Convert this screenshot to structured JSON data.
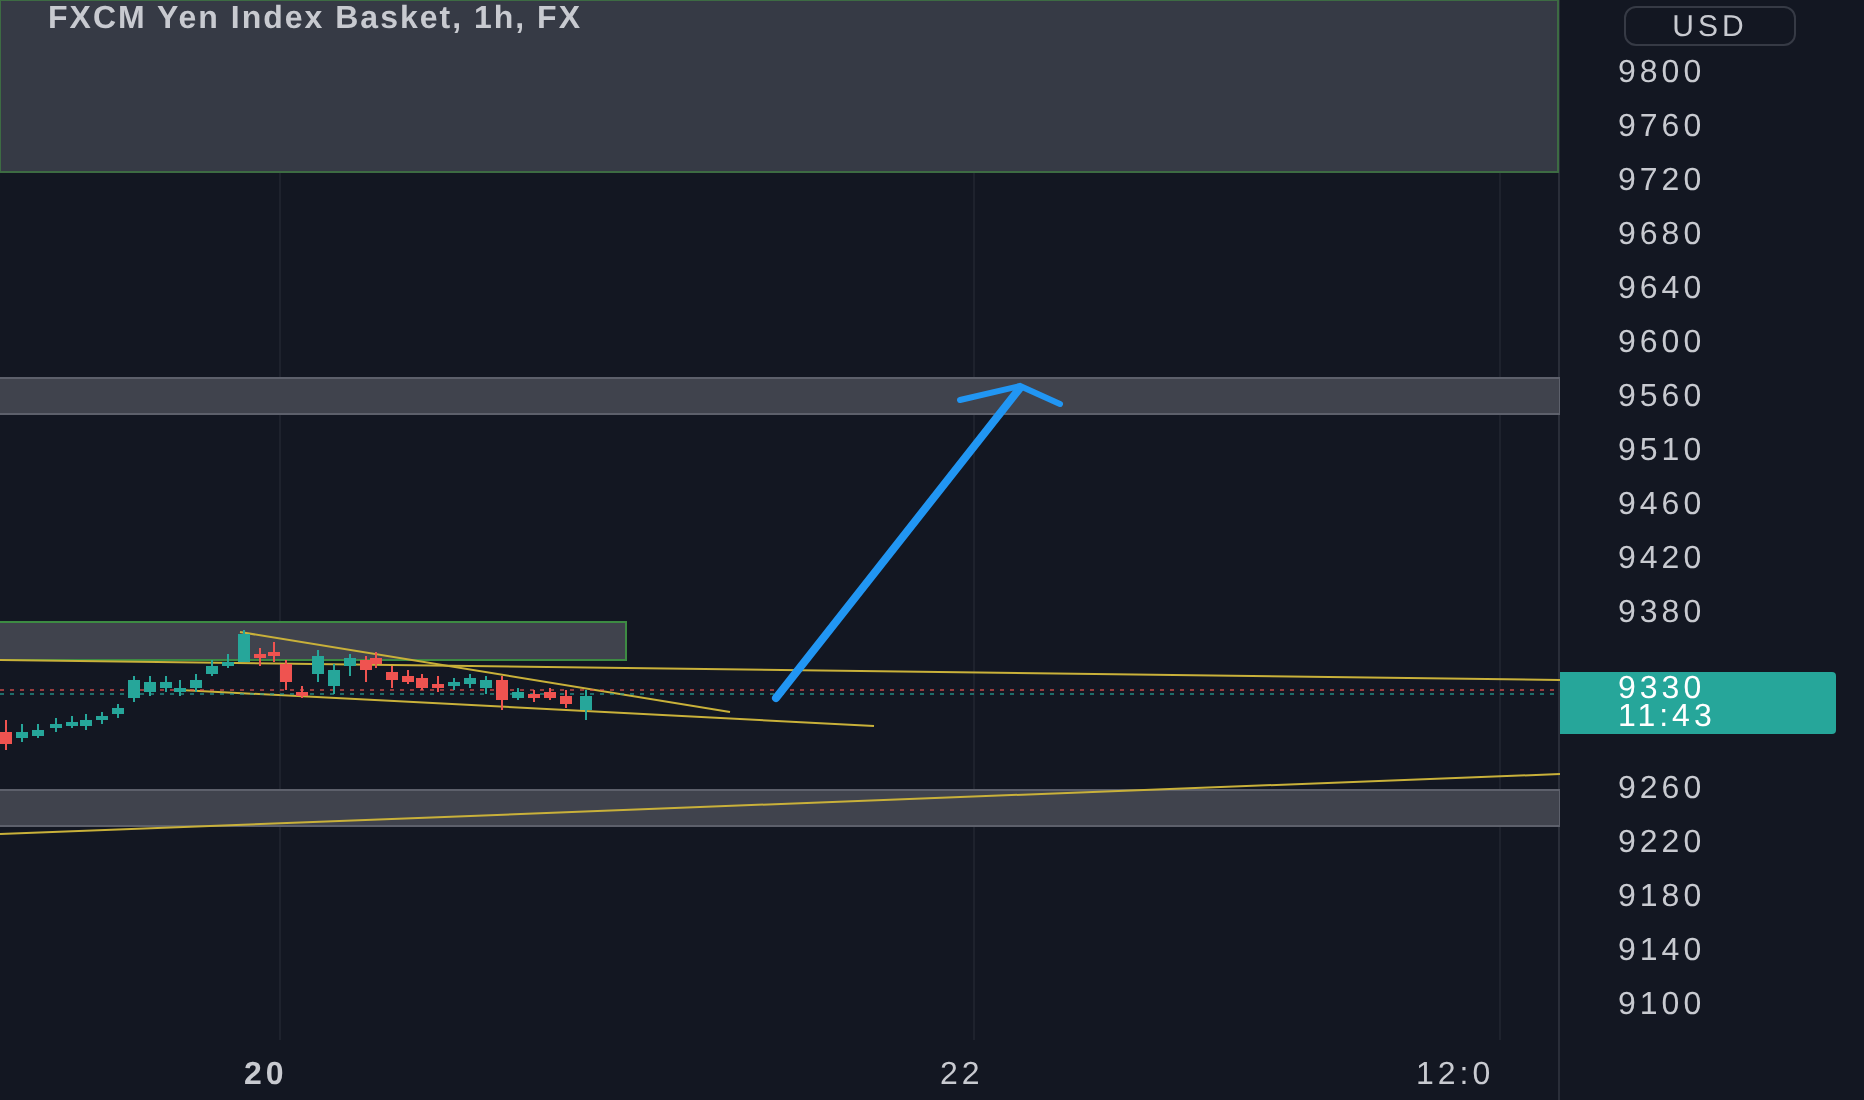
{
  "chart": {
    "title": "FXCM Yen Index Basket, 1h, FX"
  },
  "price_axis": {
    "currency": "USD",
    "labels_upper": [
      "9800",
      "9760",
      "9720",
      "9680",
      "9640",
      "9600",
      "9560",
      "9510",
      "9460",
      "9420",
      "9380"
    ],
    "last_price": {
      "price": "9330",
      "countdown": "11:43"
    },
    "labels_lower": [
      "9260",
      "9220",
      "9180",
      "9140",
      "9100"
    ]
  },
  "time_axis": {
    "labels": [
      "20",
      "22",
      "12:0"
    ]
  }
}
